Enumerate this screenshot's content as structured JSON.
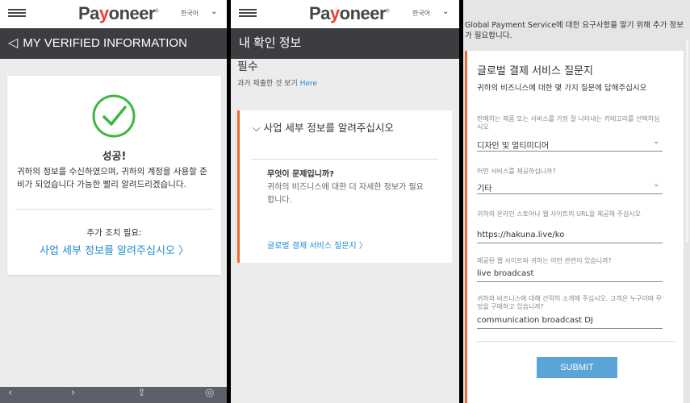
{
  "brand": {
    "pre": "Pa",
    "accent": "y",
    "post": "oneer",
    "reg": "®"
  },
  "lang": "한국어",
  "panel1": {
    "title": "MY VERIFIED INFORMATION",
    "success_title": "성공!",
    "success_desc": "귀하의 정보를 수신하였으며, 귀하의 계정을 사용할 준비가 되었습니다 가능한 빨리 알려드리겠습니다.",
    "next_label": "추가 조치 필요:",
    "next_link": "사업 세부 정보를 알려주십시오 〉"
  },
  "panel2": {
    "title": "내 확인 정보",
    "section_title": "필수",
    "past_text": "과거 제출한 것 보기",
    "past_link": "Here",
    "card_title": "사업 세부 정보를 알려주십시오",
    "question": "무엇이 문제입니까?",
    "answer": "귀하의 비즈니스에 대한 더 자세한 정보가 필요합니다.",
    "link": "글로벌 결제 서비스 질문지 〉"
  },
  "panel3": {
    "intro": "Global Payment Service에 대한 요구사항을 알기 위해 추가 정보가 필요합니다.",
    "card_title": "글로벌 결제 서비스 질문지",
    "card_sub": "귀하의 비즈니스에 대한 몇 가지 질문에 답해주십시오",
    "fields": [
      {
        "label": "판매하는 제품 또는 서비스를 가장 잘 나타내는 카테고리를 선택하십시오",
        "value": "디자인 및 멀티미디어"
      },
      {
        "label": "어떤 서비스를 제공하십니까?",
        "value": "기타"
      },
      {
        "label": "귀하의 온라인 스토어나 웹 사이트의 URL을 제공해 주십시오",
        "value": "https://hakuna.live/ko"
      },
      {
        "label": "제공된 웹 사이트와 귀하는 어떤 관련이 있습니까?",
        "value": "live broadcast"
      },
      {
        "label": "귀하의 비즈니스에 대해 간략히 소개해 주십시오. 고객은 누구이며 무엇을 구매하고 있습니까?",
        "value": "communication broadcast DJ"
      }
    ],
    "submit": "SUBMIT"
  },
  "colors": {
    "accent": "#f26a2f",
    "link": "#1d8ccf",
    "success": "#3cb83c",
    "header": "#3b3d40",
    "submit": "#5ba4d7"
  }
}
